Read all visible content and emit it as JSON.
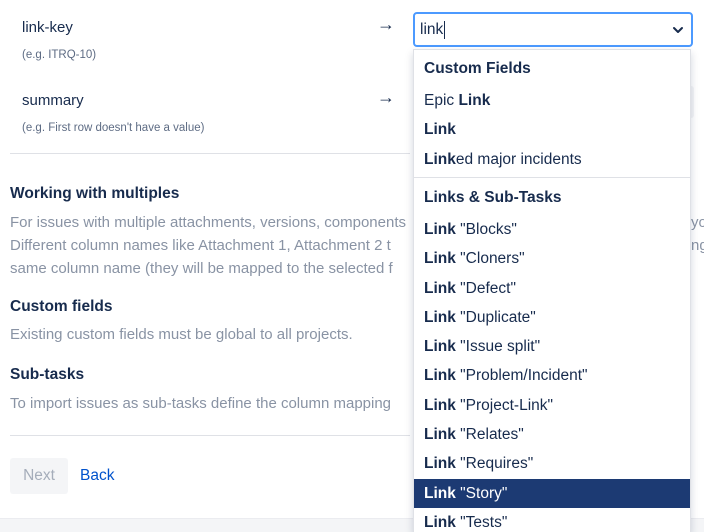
{
  "mappings": [
    {
      "name": "link-key",
      "example": "(e.g.  ITRQ-10)"
    },
    {
      "name": "summary",
      "example": "(e.g.  First row doesn't have a value)"
    }
  ],
  "arrow_glyph": "→",
  "sections": {
    "multiples": {
      "heading": "Working with multiples",
      "lines": [
        "For issues with multiple attachments, versions, components",
        "Different column names like Attachment 1, Attachment 2 t",
        "same column name (they will be mapped to the selected f"
      ]
    },
    "custom_fields": {
      "heading": "Custom fields",
      "text": "Existing custom fields must be global to all projects."
    },
    "subtasks": {
      "heading": "Sub-tasks",
      "text": "To import issues as sub-tasks define the column mapping"
    }
  },
  "overflow_text": {
    "line1_tail": "yo",
    "line2_tail": "ng"
  },
  "buttons": {
    "next": "Next",
    "back": "Back"
  },
  "select": {
    "value": "link"
  },
  "dropdown": {
    "groups": [
      {
        "heading": "Custom Fields",
        "options": [
          {
            "prefix": "Epic ",
            "bold": "Link",
            "suffix": ""
          },
          {
            "prefix": "",
            "bold": "Link",
            "suffix": ""
          },
          {
            "prefix": "",
            "bold": "Link",
            "suffix": "ed major incidents"
          }
        ]
      },
      {
        "heading": "Links & Sub-Tasks",
        "options": [
          {
            "prefix": "",
            "bold": "Link",
            "suffix": " \"Blocks\""
          },
          {
            "prefix": "",
            "bold": "Link",
            "suffix": " \"Cloners\""
          },
          {
            "prefix": "",
            "bold": "Link",
            "suffix": " \"Defect\""
          },
          {
            "prefix": "",
            "bold": "Link",
            "suffix": " \"Duplicate\""
          },
          {
            "prefix": "",
            "bold": "Link",
            "suffix": " \"Issue split\""
          },
          {
            "prefix": "",
            "bold": "Link",
            "suffix": " \"Problem/Incident\""
          },
          {
            "prefix": "",
            "bold": "Link",
            "suffix": " \"Project-Link\""
          },
          {
            "prefix": "",
            "bold": "Link",
            "suffix": " \"Relates\""
          },
          {
            "prefix": "",
            "bold": "Link",
            "suffix": " \"Requires\""
          },
          {
            "prefix": "",
            "bold": "Link",
            "suffix": " \"Story\"",
            "selected": true
          },
          {
            "prefix": "",
            "bold": "Link",
            "suffix": " \"Tests\""
          }
        ]
      }
    ]
  },
  "colors": {
    "focus_border": "#4c9aff",
    "selected_option_bg": "#1c3a73",
    "link": "#0052cc",
    "muted_text": "#8993a4"
  }
}
